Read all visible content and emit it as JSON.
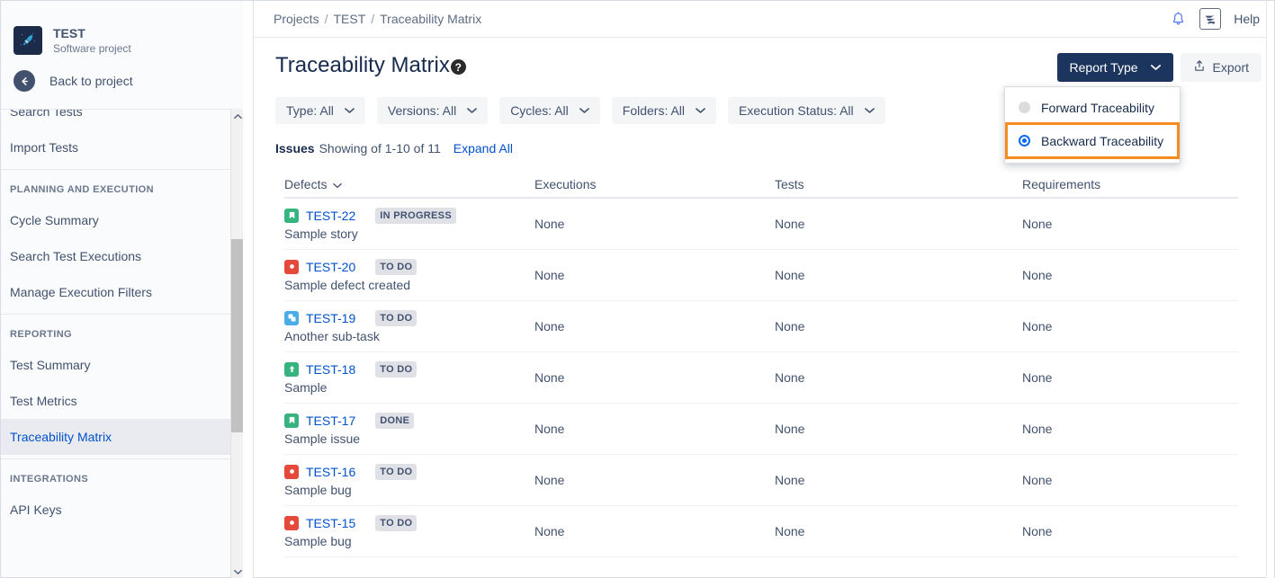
{
  "sidebar": {
    "project": {
      "name": "TEST",
      "subtitle": "Software project",
      "avatar_icon": "rocket-icon",
      "avatar_color": "#1c2b4a"
    },
    "back": {
      "label": "Back to project",
      "icon": "arrow-left-icon"
    },
    "nav": [
      {
        "label": "Search Tests",
        "type": "item",
        "active": false,
        "clipped": true
      },
      {
        "label": "Import Tests",
        "type": "item",
        "active": false
      },
      {
        "label": "PLANNING AND EXECUTION",
        "type": "group"
      },
      {
        "label": "Cycle Summary",
        "type": "item",
        "active": false
      },
      {
        "label": "Search Test Executions",
        "type": "item",
        "active": false
      },
      {
        "label": "Manage Execution Filters",
        "type": "item",
        "active": false
      },
      {
        "label": "REPORTING",
        "type": "group"
      },
      {
        "label": "Test Summary",
        "type": "item",
        "active": false
      },
      {
        "label": "Test Metrics",
        "type": "item",
        "active": false
      },
      {
        "label": "Traceability Matrix",
        "type": "item",
        "active": true
      },
      {
        "label": "INTEGRATIONS",
        "type": "group"
      },
      {
        "label": "API Keys",
        "type": "item",
        "active": false
      }
    ],
    "scrollbar": {
      "up_icon": "chevron-up-icon",
      "down_icon": "chevron-down-icon"
    }
  },
  "topbar": {
    "breadcrumb": {
      "projects": "Projects",
      "project": "TEST",
      "current": "Traceability Matrix",
      "separator": "/"
    },
    "notifications_icon": "bell-icon",
    "app_icon": "zephyr-icon",
    "help_label": "Help"
  },
  "page": {
    "title": "Traceability Matrix",
    "help_icon": "question-mark-icon"
  },
  "actions": {
    "report_type_label": "Report Type",
    "report_type_chevron": "chevron-down-icon",
    "export_label": "Export",
    "export_icon": "upload-icon"
  },
  "report_menu": {
    "open": true,
    "highlight_color": "#f68b1f",
    "selected": "Backward Traceability",
    "options": [
      {
        "label": "Forward Traceability",
        "selected": false
      },
      {
        "label": "Backward Traceability",
        "selected": true
      }
    ]
  },
  "filters": [
    {
      "label": "Type: All"
    },
    {
      "label": "Versions: All"
    },
    {
      "label": "Cycles: All"
    },
    {
      "label": "Folders: All"
    },
    {
      "label": "Execution Status: All"
    }
  ],
  "issues_bar": {
    "label": "Issues",
    "showing": "Showing of 1-10 of 11",
    "expand_all": "Expand All"
  },
  "table": {
    "columns": [
      "Defects",
      "Executions",
      "Tests",
      "Requirements"
    ],
    "sort_icon": "chevron-down-icon",
    "rows": [
      {
        "icon": "story-icon",
        "icon_class": "story",
        "key": "TEST-22",
        "status": "IN PROGRESS",
        "summary": "Sample story",
        "executions": "None",
        "tests": "None",
        "requirements": "None"
      },
      {
        "icon": "bug-icon",
        "icon_class": "bug",
        "key": "TEST-20",
        "status": "TO DO",
        "summary": "Sample defect created",
        "executions": "None",
        "tests": "None",
        "requirements": "None"
      },
      {
        "icon": "subtask-icon",
        "icon_class": "sub",
        "key": "TEST-19",
        "status": "TO DO",
        "summary": "Another sub-task",
        "executions": "None",
        "tests": "None",
        "requirements": "None"
      },
      {
        "icon": "improvement-icon",
        "icon_class": "imp",
        "key": "TEST-18",
        "status": "TO DO",
        "summary": "Sample",
        "executions": "None",
        "tests": "None",
        "requirements": "None"
      },
      {
        "icon": "story-icon",
        "icon_class": "story",
        "key": "TEST-17",
        "status": "DONE",
        "summary": "Sample issue",
        "executions": "None",
        "tests": "None",
        "requirements": "None"
      },
      {
        "icon": "bug-icon",
        "icon_class": "bug",
        "key": "TEST-16",
        "status": "TO DO",
        "summary": "Sample bug",
        "executions": "None",
        "tests": "None",
        "requirements": "None"
      },
      {
        "icon": "bug-icon",
        "icon_class": "bug",
        "key": "TEST-15",
        "status": "TO DO",
        "summary": "Sample bug",
        "executions": "None",
        "tests": "None",
        "requirements": "None"
      }
    ]
  }
}
